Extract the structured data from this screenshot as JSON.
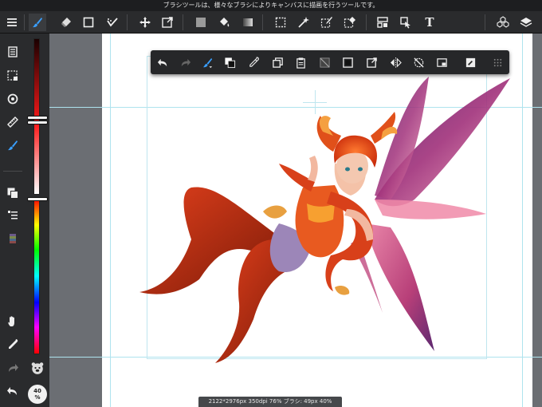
{
  "status_bar": {
    "hint_text": "ブラシツールは、様々なブラシによりキャンバスに描画を行うツールです。"
  },
  "colors": {
    "toolbar_bg": "#2a2b2d",
    "canvas_bg": "#6b6e73",
    "paper": "#ffffff",
    "guide": "#aee3ee",
    "accent_blue": "#3aa0ff"
  },
  "top_toolbar": {
    "items": [
      {
        "name": "menu-icon",
        "active": false
      },
      {
        "name": "brush-tool-icon",
        "active": true
      },
      {
        "name": "eraser-tool-icon",
        "active": false
      },
      {
        "name": "shape-tool-icon",
        "active": false
      },
      {
        "name": "blur-tool-icon",
        "active": false
      },
      {
        "name": "move-tool-icon",
        "active": false
      },
      {
        "name": "transform-tool-icon",
        "active": false
      },
      {
        "name": "fill-color-icon",
        "active": false
      },
      {
        "name": "bucket-tool-icon",
        "active": false
      },
      {
        "name": "gradient-tool-icon",
        "active": false
      },
      {
        "name": "select-tool-icon",
        "active": false
      },
      {
        "name": "magic-wand-icon",
        "active": false
      },
      {
        "name": "select-pen-icon",
        "active": false
      },
      {
        "name": "select-eraser-icon",
        "active": false
      },
      {
        "name": "frame-divider-icon",
        "active": false
      },
      {
        "name": "operation-tool-icon",
        "active": false
      },
      {
        "name": "text-tool-icon",
        "active": false
      },
      {
        "name": "materials-icon",
        "active": false
      },
      {
        "name": "layers-icon",
        "active": false
      }
    ],
    "text_tool_label": "T"
  },
  "left_tools": {
    "items": [
      "pages-icon",
      "selection-layer-icon",
      "rotate-icon",
      "ruler-icon",
      "brush-panel-icon",
      "color-swatch-icon",
      "layer-list-icon",
      "color-palette-icon",
      "hand-icon",
      "eyedropper-icon",
      "redo-icon",
      "bear-icon",
      "undo-icon"
    ]
  },
  "brush_slider": {
    "size_fraction": 0.52,
    "opacity_fraction": 0.44
  },
  "zoom": {
    "value": "40",
    "unit": "%"
  },
  "float_toolbar": {
    "items": [
      "undo-icon",
      "redo-icon",
      "brush-select-icon",
      "swap-color-icon",
      "eyedropper-icon",
      "copy-layer-icon",
      "paste-icon",
      "clear-icon",
      "fill-layer-icon",
      "transform-icon",
      "flip-icon",
      "no-snap-icon",
      "frame-icon",
      "edit-icon",
      "more-icon"
    ]
  },
  "info_bar": {
    "text": "2122*2976px 350dpi 76% ブラシ: 49px 40%"
  }
}
